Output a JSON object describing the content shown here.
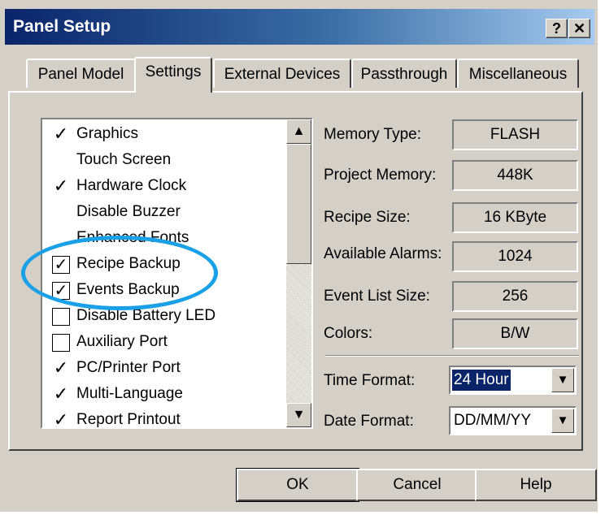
{
  "window": {
    "title": "Panel Setup",
    "help_button": "?",
    "close_button": "✕"
  },
  "tabs": [
    {
      "label": "Panel Model",
      "active": false
    },
    {
      "label": "Settings",
      "active": true
    },
    {
      "label": "External Devices",
      "active": false
    },
    {
      "label": "Passthrough",
      "active": false
    },
    {
      "label": "Miscellaneous",
      "active": false
    }
  ],
  "options": [
    {
      "label": "Graphics",
      "state": "tick",
      "mark": "✓"
    },
    {
      "label": "Touch Screen",
      "state": "none",
      "mark": ""
    },
    {
      "label": "Hardware Clock",
      "state": "tick",
      "mark": "✓"
    },
    {
      "label": "Disable Buzzer",
      "state": "none",
      "mark": ""
    },
    {
      "label": "Enhanced Fonts",
      "state": "none",
      "mark": ""
    },
    {
      "label": "Recipe Backup",
      "state": "checked",
      "mark": "✓"
    },
    {
      "label": "Events Backup",
      "state": "checked",
      "mark": "✓"
    },
    {
      "label": "Disable Battery LED",
      "state": "unchecked",
      "mark": ""
    },
    {
      "label": "Auxiliary Port",
      "state": "unchecked",
      "mark": ""
    },
    {
      "label": "PC/Printer Port",
      "state": "tick",
      "mark": "✓"
    },
    {
      "label": "Multi-Language",
      "state": "tick",
      "mark": "✓"
    },
    {
      "label": "Report Printout",
      "state": "tick",
      "mark": "✓"
    }
  ],
  "scroll": {
    "up": "▲",
    "down": "▼"
  },
  "info": [
    {
      "label": "Memory Type:",
      "value": "FLASH"
    },
    {
      "label": "Project Memory:",
      "value": "448K"
    },
    {
      "label": "Recipe Size:",
      "value": "16 KByte"
    },
    {
      "label": "Available Alarms:",
      "value": "1024"
    },
    {
      "label": "Event List Size:",
      "value": "256"
    },
    {
      "label": "Colors:",
      "value": "B/W"
    }
  ],
  "time_format": {
    "label": "Time Format:",
    "value": "24 Hour",
    "arrow": "▼"
  },
  "date_format": {
    "label": "Date Format:",
    "value": "DD/MM/YY",
    "arrow": "▼"
  },
  "buttons": {
    "ok": "OK",
    "cancel": "Cancel",
    "help": "Help"
  },
  "colors": {
    "title_bar": "#0a246a",
    "highlight_circle": "#1aa0e6",
    "dialog_face": "#d4d0c8"
  }
}
